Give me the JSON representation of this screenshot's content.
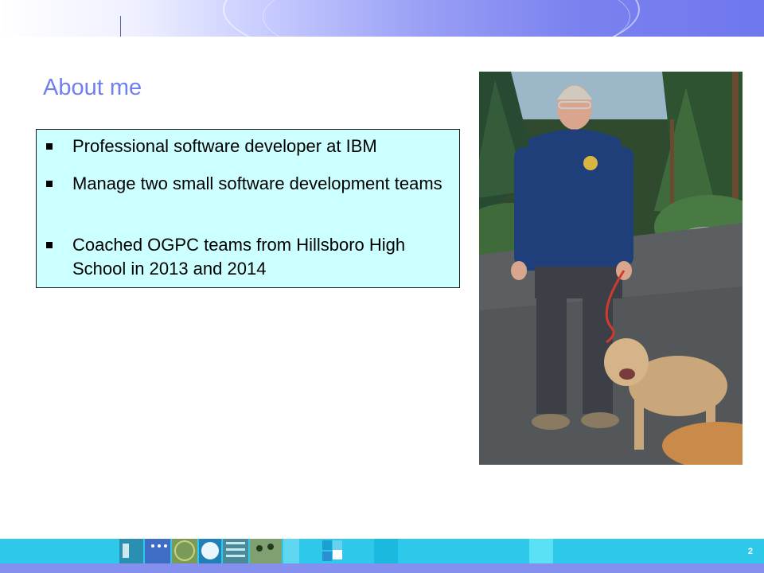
{
  "slide": {
    "title": "About me",
    "bullets": [
      "Professional software developer at IBM",
      "Manage two small software development teams",
      "Coached OGPC teams from Hillsboro High School in 2013 and 2014"
    ],
    "page_number": "2"
  },
  "photo": {
    "subject": "man with two dogs on a road among pine trees"
  },
  "colors": {
    "title": "#6f7ff0",
    "box_fill": "#ccffff",
    "footer_band": "#2ec8ea",
    "footer_bottom": "#8590ee",
    "banner_accent": "#6f77ee"
  }
}
